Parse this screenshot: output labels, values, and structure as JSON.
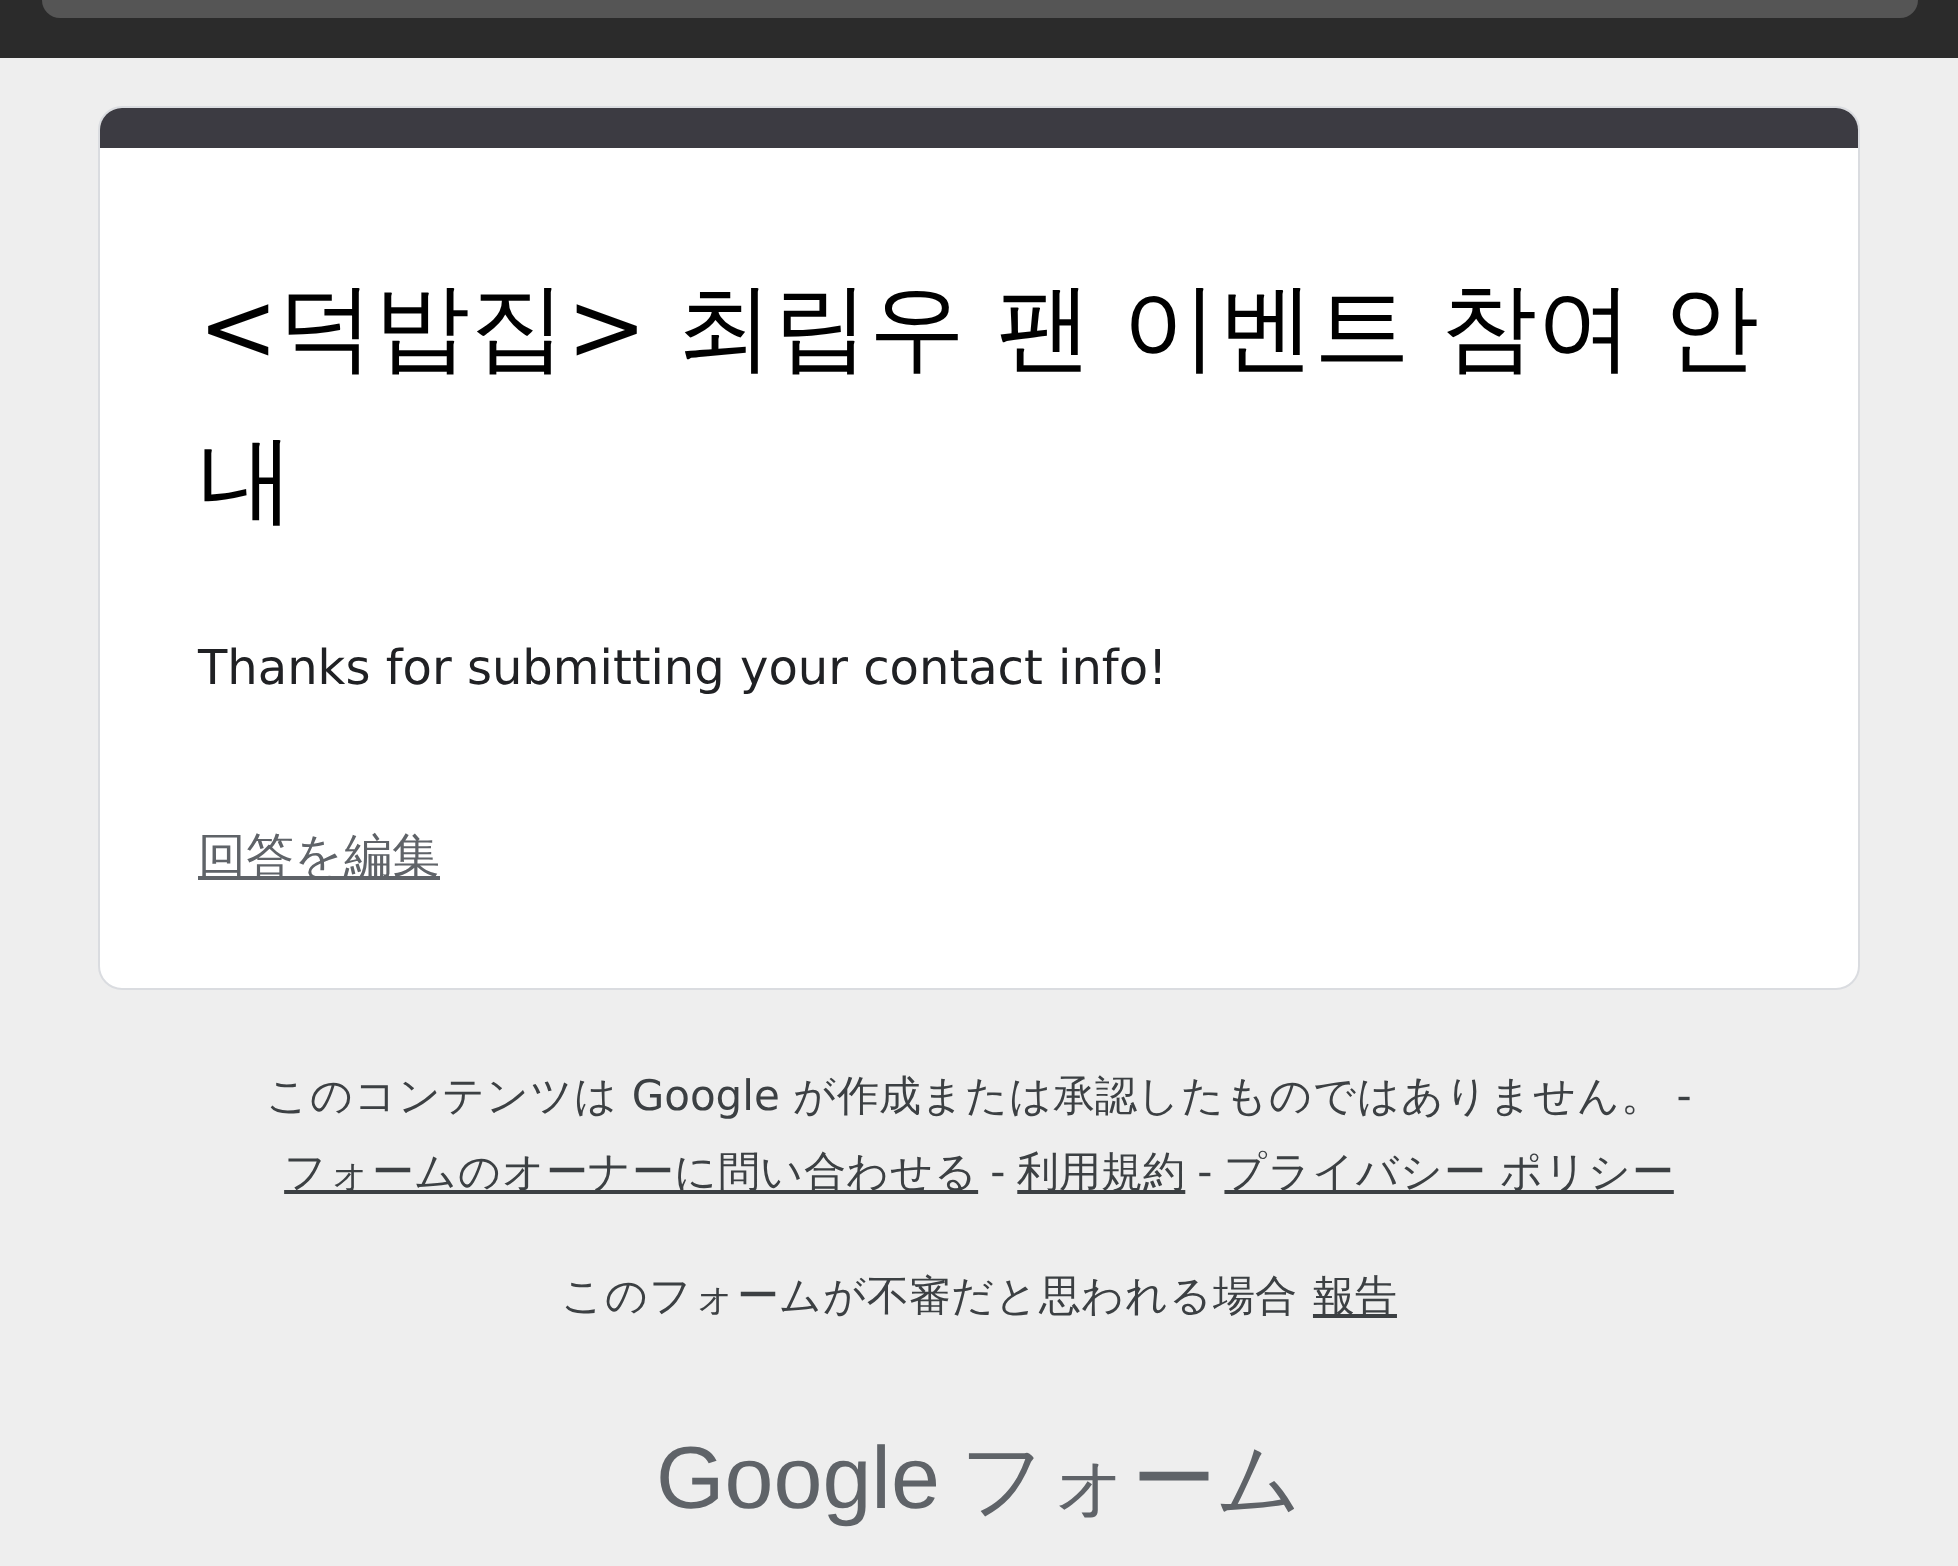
{
  "form": {
    "title": "<덕밥집> 최립우 팬 이벤트 참여 안내",
    "message": "Thanks for submitting your contact info!",
    "edit_link": "回答を編集"
  },
  "footer": {
    "disclaimer": "このコンテンツは Google が作成または承認したものではありません。 -",
    "links": [
      {
        "label": "フォームのオーナーに問い合わせる"
      },
      {
        "label": "利用規約"
      },
      {
        "label": "プライバシー ポリシー"
      }
    ],
    "separators": [
      "-",
      "-"
    ],
    "report_text": "このフォームが不審だと思われる場合",
    "report_link": "報告"
  },
  "logo": {
    "brand": "Google",
    "product": "フォーム"
  }
}
